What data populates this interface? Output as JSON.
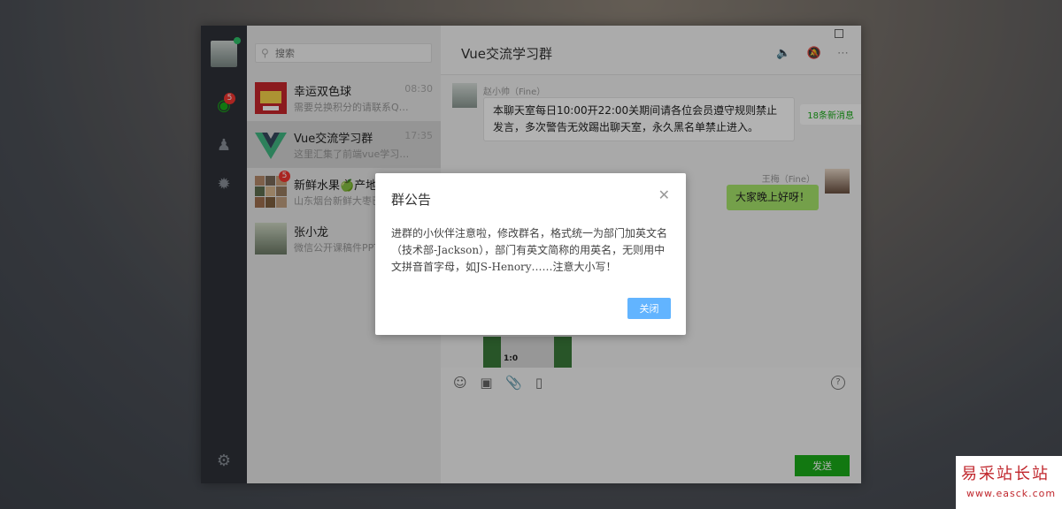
{
  "search": {
    "placeholder": "搜索"
  },
  "nav": {
    "chat_badge": "5"
  },
  "conversations": [
    {
      "name": "幸运双色球",
      "time": "08:30",
      "preview": "需要兑换积分的请联系Q…"
    },
    {
      "name": "Vue交流学习群",
      "time": "17:35",
      "preview": "这里汇集了前端vue学习…"
    },
    {
      "name": "新鲜水果🍏产地直供",
      "time": "",
      "preview": "山东烟台新鲜大枣已…",
      "badge": "5"
    },
    {
      "name": "张小龙",
      "time": "",
      "preview": "微信公开课稿件PPT…"
    }
  ],
  "chat": {
    "title": "Vue交流学习群",
    "new_messages": "18条新消息",
    "messages": [
      {
        "sender": "赵小帅（Fine）",
        "text": "本聊天室每日10:00开22:00关期间请各位会员遵守规则禁止发言，多次警告无效踢出聊天室，永久黑名单禁止进入。"
      },
      {
        "sender": "王梅（Fine）",
        "text": "大家晚上好呀！"
      }
    ],
    "image_score": "1:0",
    "send_label": "发送"
  },
  "dialog": {
    "title": "群公告",
    "body": "进群的小伙伴注意啦，修改群名，格式统一为部门加英文名（技术部-Jackson），部门有英文简称的用英名，无则用中文拼音首字母，如JS-Henory……注意大小写！",
    "close_label": "关闭"
  },
  "watermark": {
    "line1": "易采站长站",
    "line2": "www.easck.com"
  },
  "colors": {
    "accent_green": "#1aad19",
    "dialog_button": "#62b4ff",
    "badge_red": "#f43530",
    "nav_bg": "#2e3238"
  }
}
